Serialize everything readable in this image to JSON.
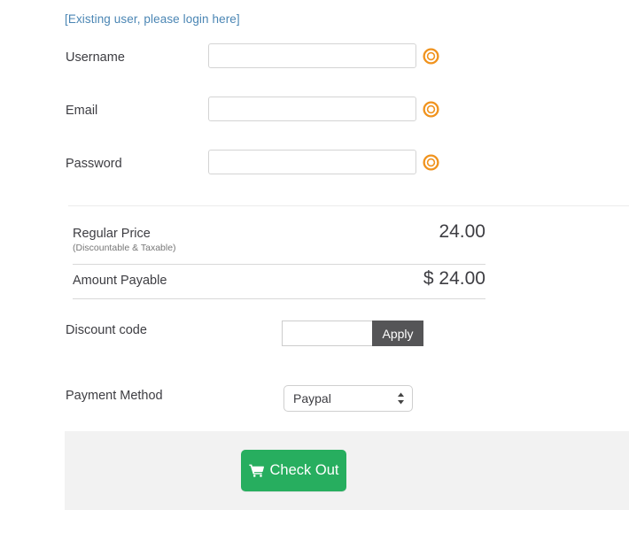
{
  "login": {
    "link_text": "[Existing user, please login here]",
    "link_color": "#4b86b4"
  },
  "form": {
    "fields": [
      {
        "label": "Username",
        "value": "",
        "placeholder": "",
        "status_icon": "required-asterisk-icon"
      },
      {
        "label": "Email",
        "value": "",
        "placeholder": "",
        "status_icon": "required-asterisk-icon"
      },
      {
        "label": "Password",
        "value": "",
        "placeholder": "",
        "status_icon": "required-asterisk-icon"
      }
    ]
  },
  "pricing": {
    "regular": {
      "name": "Regular Price",
      "sub_label": "(Discountable & Taxable)",
      "amount": "24.00"
    },
    "payable": {
      "name": "Amount Payable",
      "amount": "$ 24.00"
    }
  },
  "discount": {
    "label": "Discount code",
    "value": "",
    "placeholder": "",
    "apply_label": "Apply",
    "apply_bg": "#555557"
  },
  "payment": {
    "label": "Payment Method",
    "selected": "Paypal",
    "options": [
      "Paypal"
    ]
  },
  "checkout": {
    "label": "Check Out",
    "icon": "shopping-cart-icon",
    "button_color": "#27ae5f",
    "band_color": "#f2f2f2"
  }
}
